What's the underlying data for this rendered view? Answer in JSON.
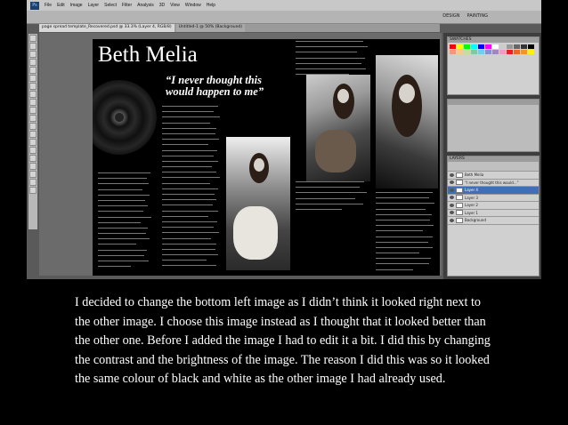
{
  "app": {
    "logo": "Ps",
    "menu": [
      "File",
      "Edit",
      "Image",
      "Layer",
      "Select",
      "Filter",
      "Analysis",
      "3D",
      "View",
      "Window",
      "Help"
    ],
    "workspace": [
      "DESIGN",
      "PAINTING"
    ],
    "tabs": [
      {
        "label": "page spread template_Recovered.psd @ 33.3% (Layer 4, RGB/8)"
      },
      {
        "label": "Untitled-1 @ 50% (Background)"
      }
    ]
  },
  "document": {
    "title": "Beth Melia",
    "quote": "“I never thought this would happen to me”"
  },
  "panels": {
    "swatches_header": "SWATCHES",
    "layers_header": "LAYERS",
    "layers": [
      {
        "name": "Beth Melia"
      },
      {
        "name": "“I never thought this would...”"
      },
      {
        "name": "Layer 4"
      },
      {
        "name": "Layer 3"
      },
      {
        "name": "Layer 2"
      },
      {
        "name": "Layer 1"
      },
      {
        "name": "Background"
      }
    ],
    "swatch_colors": [
      "#ff0000",
      "#ffff00",
      "#00ff00",
      "#00ffff",
      "#0000ff",
      "#ff00ff",
      "#ffffff",
      "#cccccc",
      "#999999",
      "#666666",
      "#333333",
      "#000000",
      "#f7977a",
      "#fdc68a",
      "#c4df9b",
      "#82ca9d",
      "#6ecff6",
      "#8493ca",
      "#a187be",
      "#f49ac2",
      "#ed1c24",
      "#f26522",
      "#f7941d",
      "#fff200"
    ]
  },
  "caption": "I decided to change the bottom left image as I didn’t think it looked right next to the other image. I choose this image instead as I thought that it looked better than the other one. Before I added the image I had to edit it  a bit. I did this by changing the contrast and the brightness of the image. The reason I did this was so it looked the same colour of black and white as the other image I had already used."
}
